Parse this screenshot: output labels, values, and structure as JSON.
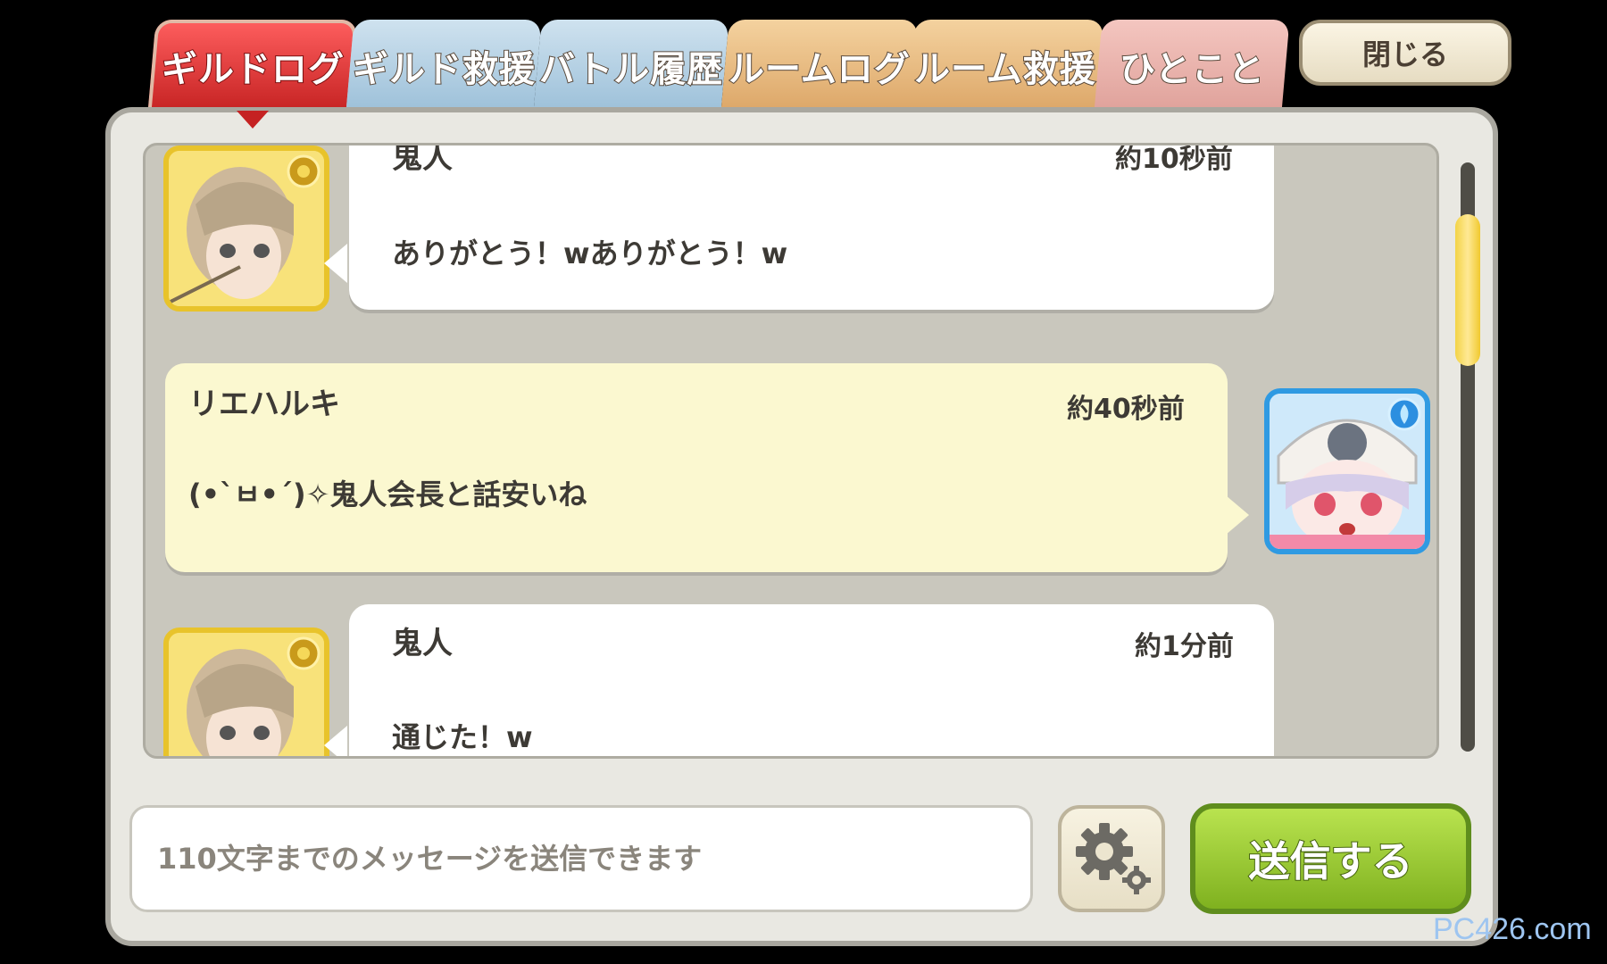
{
  "tabs": [
    {
      "label": "ギルドログ",
      "active": true
    },
    {
      "label": "ギルド救援",
      "active": false
    },
    {
      "label": "バトル履歴",
      "active": false
    },
    {
      "label": "ルームログ",
      "active": false
    },
    {
      "label": "ルーム救援",
      "active": false
    },
    {
      "label": "ひとこと",
      "active": false
    }
  ],
  "close_label": "閉じる",
  "messages": [
    {
      "name": "鬼人",
      "time": "約10秒前",
      "text": "ありがとう！wありがとう！w",
      "side": "left"
    },
    {
      "name": "リエハルキ",
      "time": "約40秒前",
      "text": "(•`ㅂ•´)✧鬼人会長と話安いね",
      "side": "right"
    },
    {
      "name": "鬼人",
      "time": "約1分前",
      "text": "通じた！w",
      "side": "left"
    }
  ],
  "input": {
    "placeholder": "110文字までのメッセージを送信できます",
    "value": ""
  },
  "send_label": "送信する",
  "watermark": "PC426.com",
  "colors": {
    "active_tab": "#d83232",
    "send_button": "#8fc12b",
    "scroll_thumb": "#f3d346"
  },
  "icons": [
    "gear-icon",
    "avatar-badge-icon"
  ]
}
